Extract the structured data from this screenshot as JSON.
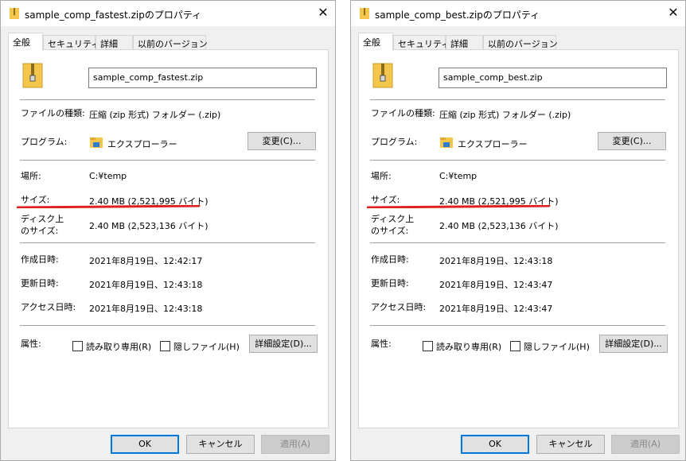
{
  "colors": {
    "underline": "#e02020",
    "focus": "#0078d7"
  },
  "icons": {
    "title": "zip-folder-icon",
    "close": "close-icon",
    "program": "explorer-folder-icon"
  },
  "dialogs": [
    {
      "title": "sample_comp_fastest.zipのプロパティ",
      "close": "✕",
      "tabs": [
        "全般",
        "セキュリティ",
        "詳細",
        "以前のバージョン"
      ],
      "filename": "sample_comp_fastest.zip",
      "labels": {
        "type": "ファイルの種類:",
        "program": "プログラム:",
        "location": "場所:",
        "size": "サイズ:",
        "disk_size_1": "ディスク上",
        "disk_size_2": "のサイズ:",
        "created": "作成日時:",
        "modified": "更新日時:",
        "accessed": "アクセス日時:",
        "attributes": "属性:"
      },
      "type": "圧縮 (zip 形式) フォルダー (.zip)",
      "program": "エクスプローラー",
      "change_button": "変更(C)...",
      "location": "C:¥temp",
      "size": "2.40 MB (2,521,995 バイト)",
      "disk_size": "2.40 MB (2,523,136 バイト)",
      "created": "2021年8月19日、12:42:17",
      "modified": "2021年8月19日、12:43:18",
      "accessed": "2021年8月19日、12:43:18",
      "readonly_label": "読み取り専用(R)",
      "hidden_label": "隠しファイル(H)",
      "advanced_button": "詳細設定(D)...",
      "ok": "OK",
      "cancel": "キャンセル",
      "apply": "適用(A)"
    },
    {
      "title": "sample_comp_best.zipのプロパティ",
      "close": "✕",
      "tabs": [
        "全般",
        "セキュリティ",
        "詳細",
        "以前のバージョン"
      ],
      "filename": "sample_comp_best.zip",
      "labels": {
        "type": "ファイルの種類:",
        "program": "プログラム:",
        "location": "場所:",
        "size": "サイズ:",
        "disk_size_1": "ディスク上",
        "disk_size_2": "のサイズ:",
        "created": "作成日時:",
        "modified": "更新日時:",
        "accessed": "アクセス日時:",
        "attributes": "属性:"
      },
      "type": "圧縮 (zip 形式) フォルダー (.zip)",
      "program": "エクスプローラー",
      "change_button": "変更(C)...",
      "location": "C:¥temp",
      "size": "2.40 MB (2,521,995 バイト)",
      "disk_size": "2.40 MB (2,523,136 バイト)",
      "created": "2021年8月19日、12:43:18",
      "modified": "2021年8月19日、12:43:47",
      "accessed": "2021年8月19日、12:43:47",
      "readonly_label": "読み取り専用(R)",
      "hidden_label": "隠しファイル(H)",
      "advanced_button": "詳細設定(D)...",
      "ok": "OK",
      "cancel": "キャンセル",
      "apply": "適用(A)"
    }
  ]
}
